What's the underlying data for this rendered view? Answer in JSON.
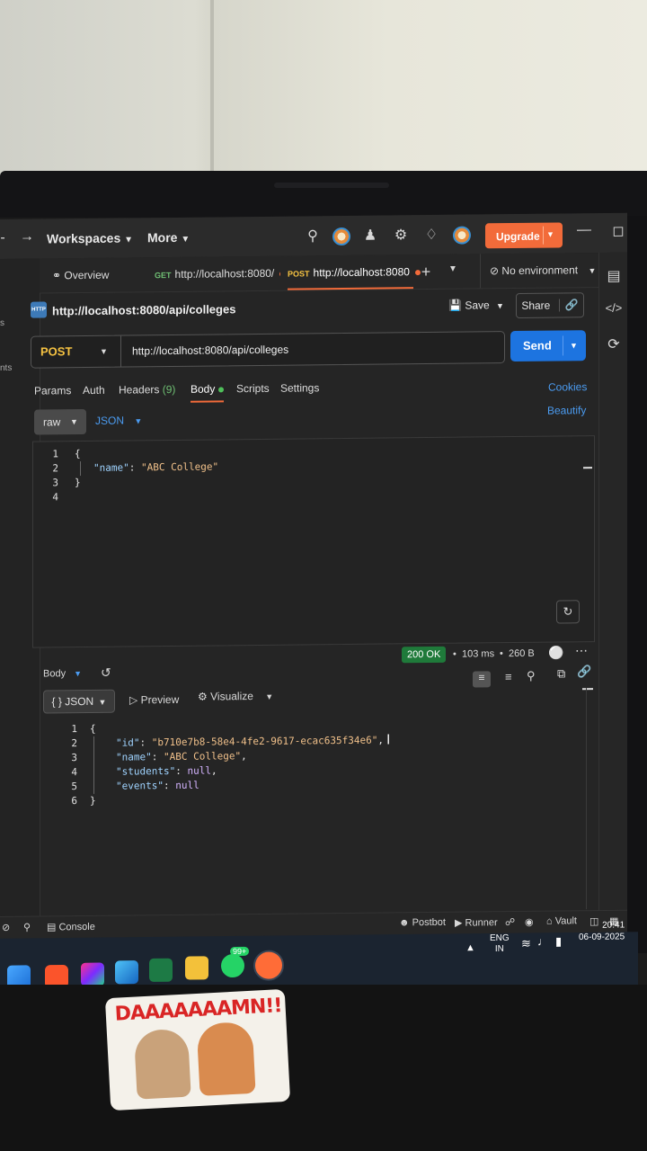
{
  "topbar": {
    "back_arrow": "→",
    "workspaces": "Workspaces",
    "more": "More",
    "upgrade": "Upgrade"
  },
  "tabs": [
    {
      "label": "Overview"
    },
    {
      "method": "GET",
      "label": "http://localhost:8080/"
    },
    {
      "method": "POST",
      "label": "http://localhost:8080"
    }
  ],
  "environment": "No environment",
  "request": {
    "name": "http://localhost:8080/api/colleges",
    "save": "Save",
    "share": "Share",
    "method": "POST",
    "url": "http://localhost:8080/api/colleges",
    "send": "Send"
  },
  "request_tabs": {
    "params": "Params",
    "auth": "Auth",
    "headers": "Headers",
    "headers_count": "(9)",
    "body": "Body",
    "scripts": "Scripts",
    "settings": "Settings",
    "cookies": "Cookies",
    "beautify": "Beautify"
  },
  "body_mode": {
    "raw": "raw",
    "format": "JSON"
  },
  "request_body": {
    "line_numbers": [
      "1",
      "2",
      "3",
      "4"
    ],
    "open": "{",
    "key": "\"name\"",
    "value": "\"ABC College\"",
    "close": "}"
  },
  "response": {
    "status": "200 OK",
    "time": "103 ms",
    "size": "260 B",
    "body_label": "Body",
    "format": "{ } JSON",
    "preview": "Preview",
    "visualize": "Visualize",
    "line_numbers": [
      "1",
      "2",
      "3",
      "4",
      "5",
      "6"
    ],
    "id_key": "\"id\"",
    "id_value": "\"b710e7b8-58e4-4fe2-9617-ecac635f34e6\"",
    "name_key": "\"name\"",
    "name_value": "\"ABC College\"",
    "students_key": "\"students\"",
    "events_key": "\"events\"",
    "null": "null",
    "open": "{",
    "close": "}"
  },
  "statusbar": {
    "console": "Console",
    "postbot": "Postbot",
    "runner": "Runner",
    "vault": "Vault"
  },
  "taskbar": {
    "lang": "ENG",
    "region": "IN",
    "time": "20:41",
    "date": "06-09-2025",
    "whatsapp_badge": "99+"
  },
  "sticker": {
    "text": "DAAAAAAAMN!!"
  },
  "colors": {
    "accent_orange": "#f26b3a",
    "send_blue": "#1d74e0",
    "post_yellow": "#f5c242",
    "get_green": "#6fbf73",
    "status_green": "#1f7a3a"
  }
}
